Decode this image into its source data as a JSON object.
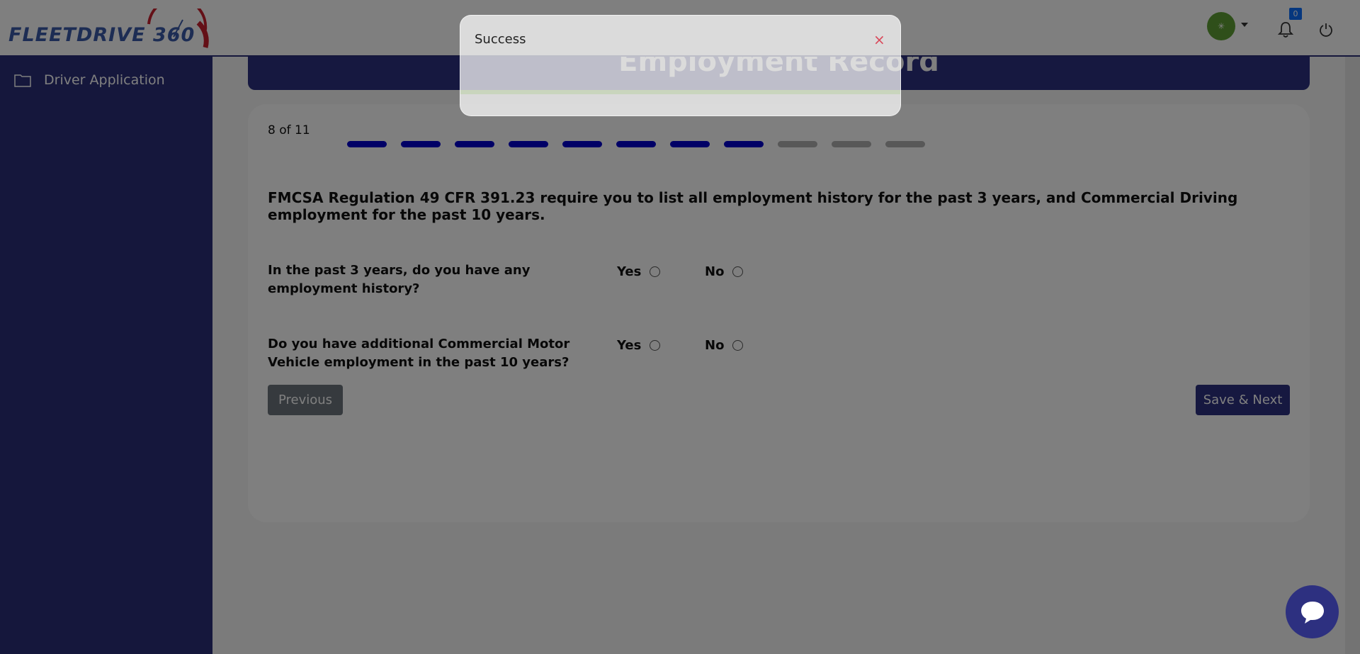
{
  "header": {
    "logo_text": "FLEETDRIVE 360",
    "avatar_initial": "✳",
    "notification_count": "0"
  },
  "sidebar": {
    "items": [
      {
        "label": "Driver Application",
        "icon": "folder-icon"
      }
    ]
  },
  "main": {
    "banner_title": "Employment Record",
    "step_label": "8 of 11",
    "steps_total": 11,
    "steps_completed": 8,
    "colors": {
      "step_active": "#0000cc",
      "step_inactive": "#b0b0b0",
      "brand": "#2d3080"
    },
    "intro": "FMCSA Regulation 49 CFR 391.23 require you to list all employment history for the past 3 years, and Commercial Driving employment for the past 10 years.",
    "questions": [
      {
        "label": "In the past 3 years, do you have any employment history?",
        "yes": "Yes",
        "no": "No"
      },
      {
        "label": "Do you have additional Commercial Motor Vehicle employment in the past 10 years?",
        "yes": "Yes",
        "no": "No"
      }
    ],
    "buttons": {
      "previous": "Previous",
      "save_next": "Save & Next"
    }
  },
  "toast": {
    "message": "Success",
    "close": "×"
  }
}
